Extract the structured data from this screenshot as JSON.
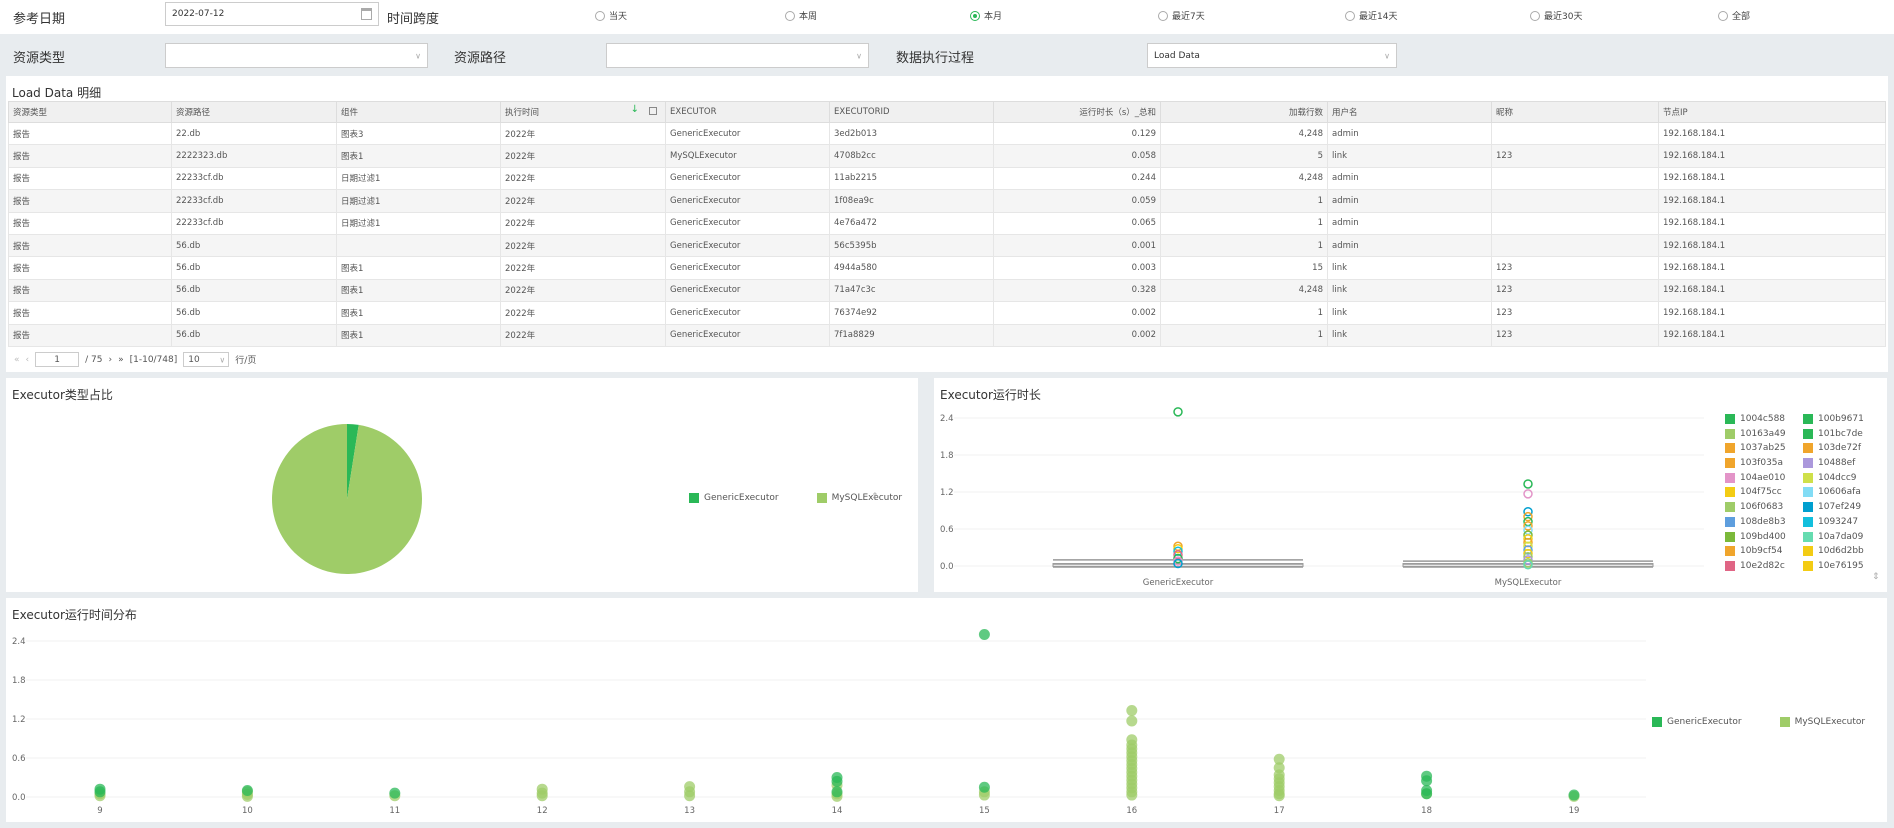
{
  "filters": {
    "ref_date_label": "参考日期",
    "ref_date_value": "2022-07-12",
    "span_label": "时间跨度",
    "span_options": [
      {
        "label": "当天",
        "selected": false
      },
      {
        "label": "本周",
        "selected": false
      },
      {
        "label": "本月",
        "selected": true
      },
      {
        "label": "最近7天",
        "selected": false
      },
      {
        "label": "最近14天",
        "selected": false
      },
      {
        "label": "最近30天",
        "selected": false
      },
      {
        "label": "全部",
        "selected": false
      }
    ],
    "resource_type_label": "资源类型",
    "resource_type_value": "",
    "resource_path_label": "资源路径",
    "resource_path_value": "",
    "process_label": "数据执行过程",
    "process_value": "Load Data"
  },
  "table": {
    "title": "Load Data 明细",
    "columns": [
      "资源类型",
      "资源路径",
      "组件",
      "执行时间",
      "EXECUTOR",
      "EXECUTORID",
      "运行时长（s）_总和",
      "加载行数",
      "用户名",
      "昵称",
      "节点IP"
    ],
    "rows": [
      [
        "报告",
        "22.db",
        "图表3",
        "2022年",
        "GenericExecutor",
        "3ed2b013",
        "0.129",
        "4,248",
        "admin",
        "",
        "192.168.184.1"
      ],
      [
        "报告",
        "2222323.db",
        "图表1",
        "2022年",
        "MySQLExecutor",
        "4708b2cc",
        "0.058",
        "5",
        "link",
        "123",
        "192.168.184.1"
      ],
      [
        "报告",
        "22233cf.db",
        "日期过滤1",
        "2022年",
        "GenericExecutor",
        "11ab2215",
        "0.244",
        "4,248",
        "admin",
        "",
        "192.168.184.1"
      ],
      [
        "报告",
        "22233cf.db",
        "日期过滤1",
        "2022年",
        "GenericExecutor",
        "1f08ea9c",
        "0.059",
        "1",
        "admin",
        "",
        "192.168.184.1"
      ],
      [
        "报告",
        "22233cf.db",
        "日期过滤1",
        "2022年",
        "GenericExecutor",
        "4e76a472",
        "0.065",
        "1",
        "admin",
        "",
        "192.168.184.1"
      ],
      [
        "报告",
        "56.db",
        "",
        "2022年",
        "GenericExecutor",
        "56c5395b",
        "0.001",
        "1",
        "admin",
        "",
        "192.168.184.1"
      ],
      [
        "报告",
        "56.db",
        "图表1",
        "2022年",
        "GenericExecutor",
        "4944a580",
        "0.003",
        "15",
        "link",
        "123",
        "192.168.184.1"
      ],
      [
        "报告",
        "56.db",
        "图表1",
        "2022年",
        "GenericExecutor",
        "71a47c3c",
        "0.328",
        "4,248",
        "link",
        "123",
        "192.168.184.1"
      ],
      [
        "报告",
        "56.db",
        "图表1",
        "2022年",
        "GenericExecutor",
        "76374e92",
        "0.002",
        "1",
        "link",
        "123",
        "192.168.184.1"
      ],
      [
        "报告",
        "56.db",
        "图表1",
        "2022年",
        "GenericExecutor",
        "7f1a8829",
        "0.002",
        "1",
        "link",
        "123",
        "192.168.184.1"
      ]
    ],
    "pager": {
      "page": "1",
      "total_pages": "/ 75",
      "range": "[1-10/748]",
      "page_size": "10",
      "page_size_suffix": "行/页"
    }
  },
  "colors": {
    "generic": "#2ab857",
    "mysql": "#9fcc68",
    "accent": "#2ab857"
  },
  "chart_data": [
    {
      "type": "pie",
      "title": "Executor类型占比",
      "legend_position": "right",
      "categories": [
        "GenericExecutor",
        "MySQLExecutor"
      ],
      "values": [
        2.5,
        97.5
      ]
    },
    {
      "type": "boxplot",
      "title": "Executor运行时长",
      "categories": [
        "GenericExecutor",
        "MySQLExecutor"
      ],
      "ylim": [
        0,
        2.4
      ],
      "yticks": [
        "0.0",
        "0.6",
        "1.2",
        "1.8",
        "2.4"
      ],
      "grid": true,
      "legend_position": "right",
      "boxes": [
        {
          "min": 0,
          "q1": 0.0,
          "median": 0.02,
          "q3": 0.04,
          "max": 0.1
        },
        {
          "min": 0,
          "q1": 0.0,
          "median": 0.02,
          "q3": 0.04,
          "max": 0.08
        }
      ],
      "outliers": [
        [
          2.5,
          0.32,
          0.28,
          0.24,
          0.18,
          0.12,
          0.08,
          0.04
        ],
        [
          1.33,
          1.17,
          0.88,
          0.8,
          0.72,
          0.65,
          0.58,
          0.5,
          0.44,
          0.38,
          0.32,
          0.26,
          0.2,
          0.15,
          0.1,
          0.05,
          0.02
        ]
      ],
      "legend": [
        {
          "name": "1004c588",
          "color": "#2ab857"
        },
        {
          "name": "100b9671",
          "color": "#2ab857"
        },
        {
          "name": "10163a49",
          "color": "#9fcc68"
        },
        {
          "name": "101bc7de",
          "color": "#2ab857"
        },
        {
          "name": "1037ab25",
          "color": "#f0a52c"
        },
        {
          "name": "103de72f",
          "color": "#f0a52c"
        },
        {
          "name": "103f035a",
          "color": "#f0a52c"
        },
        {
          "name": "10488ef",
          "color": "#ab98dc"
        },
        {
          "name": "104ae010",
          "color": "#e394c8"
        },
        {
          "name": "104dcc9",
          "color": "#cfe04a"
        },
        {
          "name": "104f75cc",
          "color": "#f3cc14"
        },
        {
          "name": "10606afa",
          "color": "#82dcf5"
        },
        {
          "name": "106f0683",
          "color": "#9fcc68"
        },
        {
          "name": "107ef249",
          "color": "#009fcf"
        },
        {
          "name": "108de8b3",
          "color": "#5e9ede"
        },
        {
          "name": "1093247",
          "color": "#13bfdd"
        },
        {
          "name": "109bd400",
          "color": "#7bb93a"
        },
        {
          "name": "10a7da09",
          "color": "#66dcb0"
        },
        {
          "name": "10b9cf54",
          "color": "#f0a52c"
        },
        {
          "name": "10d6d2bb",
          "color": "#f3cc14"
        },
        {
          "name": "10e2d82c",
          "color": "#e06585"
        },
        {
          "name": "10e76195",
          "color": "#f3cc14"
        }
      ]
    },
    {
      "type": "scatter",
      "title": "Executor运行时间分布",
      "x": [
        9,
        10,
        11,
        12,
        13,
        14,
        15,
        16,
        17,
        18,
        19
      ],
      "ylim": [
        0,
        2.4
      ],
      "yticks": [
        "0.0",
        "0.6",
        "1.2",
        "1.8",
        "2.4"
      ],
      "grid": true,
      "legend_position": "right",
      "series": [
        {
          "name": "GenericExecutor",
          "points": [
            [
              9,
              0.12
            ],
            [
              9,
              0.08
            ],
            [
              10,
              0.1
            ],
            [
              11,
              0.06
            ],
            [
              14,
              0.3
            ],
            [
              14,
              0.24
            ],
            [
              14,
              0.08
            ],
            [
              15,
              2.5
            ],
            [
              15,
              0.15
            ],
            [
              18,
              0.32
            ],
            [
              18,
              0.25
            ],
            [
              18,
              0.1
            ],
            [
              18,
              0.05
            ],
            [
              19,
              0.03
            ]
          ]
        },
        {
          "name": "MySQLExecutor",
          "points": [
            [
              9,
              0.02
            ],
            [
              9,
              0.05
            ],
            [
              10,
              0.08
            ],
            [
              10,
              0.04
            ],
            [
              10,
              0.01
            ],
            [
              11,
              0.02
            ],
            [
              12,
              0.12
            ],
            [
              12,
              0.06
            ],
            [
              12,
              0.02
            ],
            [
              13,
              0.16
            ],
            [
              13,
              0.08
            ],
            [
              13,
              0.02
            ],
            [
              14,
              0.18
            ],
            [
              14,
              0.05
            ],
            [
              14,
              0.01
            ],
            [
              15,
              0.08
            ],
            [
              15,
              0.03
            ],
            [
              16,
              1.33
            ],
            [
              16,
              1.17
            ],
            [
              16,
              0.88
            ],
            [
              16,
              0.8
            ],
            [
              16,
              0.74
            ],
            [
              16,
              0.68
            ],
            [
              16,
              0.62
            ],
            [
              16,
              0.56
            ],
            [
              16,
              0.5
            ],
            [
              16,
              0.44
            ],
            [
              16,
              0.38
            ],
            [
              16,
              0.32
            ],
            [
              16,
              0.26
            ],
            [
              16,
              0.2
            ],
            [
              16,
              0.14
            ],
            [
              16,
              0.08
            ],
            [
              16,
              0.03
            ],
            [
              17,
              0.58
            ],
            [
              17,
              0.45
            ],
            [
              17,
              0.34
            ],
            [
              17,
              0.28
            ],
            [
              17,
              0.22
            ],
            [
              17,
              0.16
            ],
            [
              17,
              0.1
            ],
            [
              17,
              0.05
            ],
            [
              17,
              0.02
            ],
            [
              18,
              0.05
            ],
            [
              19,
              0.01
            ]
          ]
        }
      ]
    }
  ]
}
